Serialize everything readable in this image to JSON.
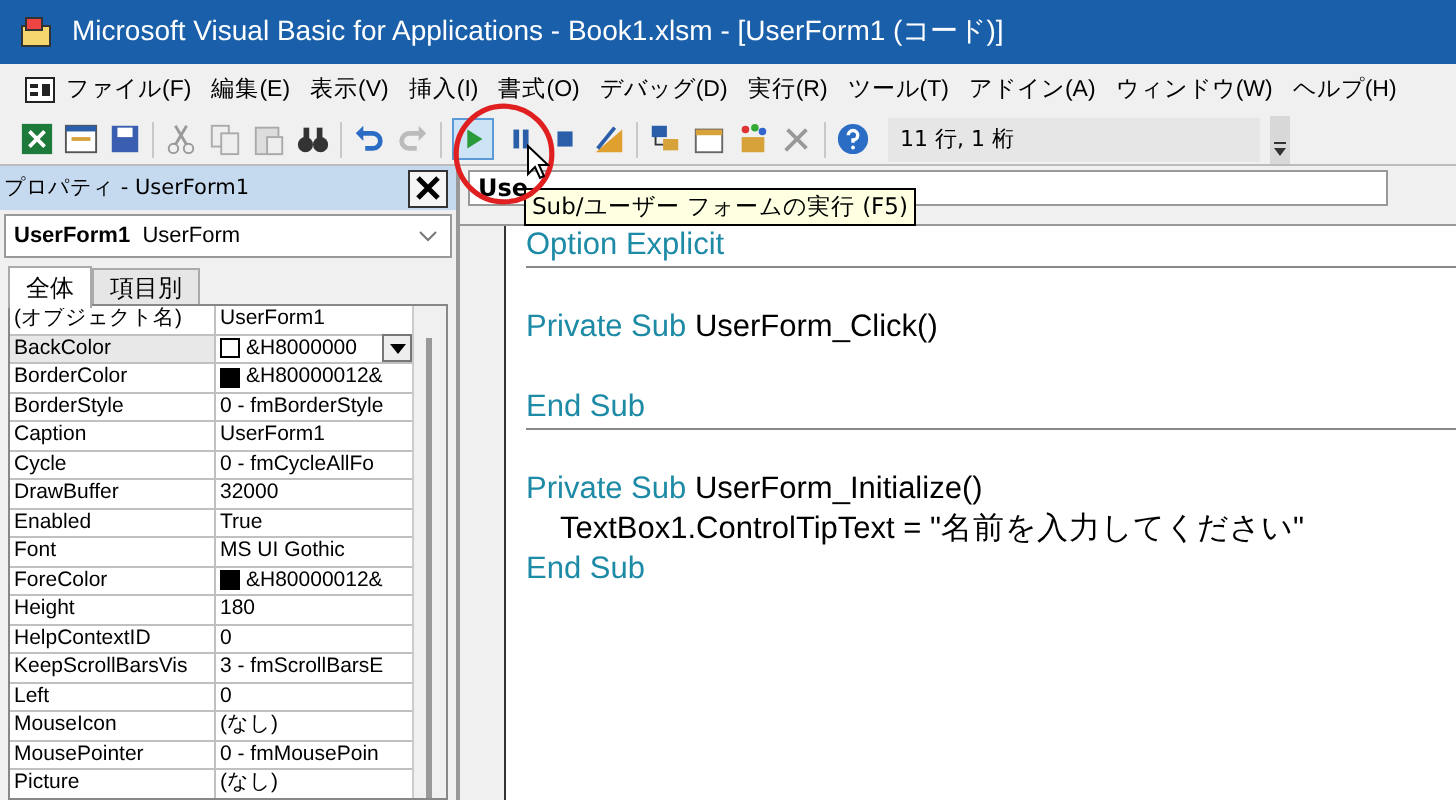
{
  "window": {
    "title": "Microsoft Visual Basic for Applications - Book1.xlsm - [UserForm1 (コード)]"
  },
  "menu": [
    "ファイル(F)",
    "編集(E)",
    "表示(V)",
    "挿入(I)",
    "書式(O)",
    "デバッグ(D)",
    "実行(R)",
    "ツール(T)",
    "アドイン(A)",
    "ウィンドウ(W)",
    "ヘルプ(H)"
  ],
  "toolbar": {
    "position": "11 行, 1 桁",
    "tooltip": "Sub/ユーザー フォームの実行 (F5)"
  },
  "properties": {
    "title": "プロパティ - UserForm1",
    "object_name": "UserForm1",
    "object_type": "UserForm",
    "tabs": [
      {
        "label": "全体",
        "selected": true
      },
      {
        "label": "項目別",
        "selected": false
      }
    ],
    "rows": [
      {
        "name": "(オブジェクト名)",
        "value": "UserForm1",
        "selected": false
      },
      {
        "name": "BackColor",
        "value": "&H8000000",
        "color": "#ffffff",
        "selected": true
      },
      {
        "name": "BorderColor",
        "value": "&H80000012&",
        "color": "#000000",
        "selected": false
      },
      {
        "name": "BorderStyle",
        "value": "0 - fmBorderStyle",
        "selected": false
      },
      {
        "name": "Caption",
        "value": "UserForm1",
        "selected": false
      },
      {
        "name": "Cycle",
        "value": "0 - fmCycleAllFo",
        "selected": false
      },
      {
        "name": "DrawBuffer",
        "value": "32000",
        "selected": false
      },
      {
        "name": "Enabled",
        "value": "True",
        "selected": false
      },
      {
        "name": "Font",
        "value": "MS UI Gothic",
        "selected": false
      },
      {
        "name": "ForeColor",
        "value": "&H80000012&",
        "color": "#000000",
        "selected": false
      },
      {
        "name": "Height",
        "value": "180",
        "selected": false
      },
      {
        "name": "HelpContextID",
        "value": "0",
        "selected": false
      },
      {
        "name": "KeepScrollBarsVis",
        "value": "3 - fmScrollBarsE",
        "selected": false
      },
      {
        "name": "Left",
        "value": "0",
        "selected": false
      },
      {
        "name": "MouseIcon",
        "value": "(なし)",
        "selected": false
      },
      {
        "name": "MousePointer",
        "value": "0 - fmMousePoin",
        "selected": false
      },
      {
        "name": "Picture",
        "value": "(なし)",
        "selected": false
      }
    ]
  },
  "code": {
    "object_dropdown": "Use",
    "blocks": [
      {
        "paragraphs": [
          [
            [
              {
                "kind": "keyword",
                "text": "Option Explicit"
              }
            ]
          ]
        ]
      },
      {
        "paragraphs": [
          [
            [
              {
                "kind": "keyword",
                "text": "Private Sub "
              },
              {
                "kind": "plain",
                "text": "UserForm_Click()"
              }
            ]
          ],
          [
            [
              {
                "kind": "keyword",
                "text": "End Sub"
              }
            ]
          ]
        ]
      },
      {
        "paragraphs": [
          [
            [
              {
                "kind": "keyword",
                "text": "Private Sub "
              },
              {
                "kind": "plain",
                "text": "UserForm_Initialize()"
              }
            ],
            [
              {
                "kind": "plain",
                "text": "    TextBox1.ControlTipText = \"名前を入力してください\""
              }
            ],
            [
              {
                "kind": "keyword",
                "text": "End Sub"
              }
            ]
          ]
        ]
      }
    ]
  }
}
